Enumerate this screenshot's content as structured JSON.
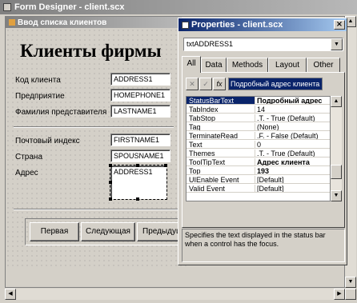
{
  "designer": {
    "title": "Form Designer - client.scx",
    "form_caption": "Ввод списка клиентов",
    "heading": "Клиенты фирмы",
    "fields": [
      {
        "label": "Код клиента",
        "value": "ADDRESS1"
      },
      {
        "label": "Предприятие",
        "value": "HOMEPHONE1"
      },
      {
        "label": "Фамилия представителя",
        "value": "LASTNAME1"
      },
      {
        "label": "Почтовый индекс",
        "value": "FIRSTNAME1"
      },
      {
        "label": "Страна",
        "value": "SPOUSNAME1"
      },
      {
        "label": "Адрес",
        "value": "ADDRESS1"
      }
    ],
    "buttons": [
      "Первая",
      "Следующая",
      "Предыдущая"
    ]
  },
  "properties": {
    "title": "Properties - client.scx",
    "object": "txtADDRESS1",
    "tabs": [
      "All",
      "Data",
      "Methods",
      "Layout",
      "Other"
    ],
    "active_tab": "All",
    "edit_value": "Подробный адрес клиента",
    "tool_icons": [
      "cancel-x-icon",
      "accept-check-icon",
      "function-fx-icon"
    ],
    "rows": [
      {
        "name": "StatusBarText",
        "value": "Подробный адрес"
      },
      {
        "name": "TabIndex",
        "value": "14"
      },
      {
        "name": "TabStop",
        "value": ".T. - True (Default)"
      },
      {
        "name": "Tag",
        "value": "(None)"
      },
      {
        "name": "TerminateRead",
        "value": ".F. - False (Default)"
      },
      {
        "name": "Text",
        "value": "0"
      },
      {
        "name": "Themes",
        "value": ".T. - True (Default)"
      },
      {
        "name": "ToolTipText",
        "value": "Адрес клиента"
      },
      {
        "name": "Top",
        "value": "193"
      },
      {
        "name": "UIEnable Event",
        "value": "[Default]"
      },
      {
        "name": "Valid Event",
        "value": "[Default]"
      }
    ],
    "description": "Specifies the text displayed in the status bar when a control has the focus."
  },
  "colors": {
    "active_title": "#0a246a",
    "inactive_title": "#808080",
    "face": "#d4d0c8"
  }
}
